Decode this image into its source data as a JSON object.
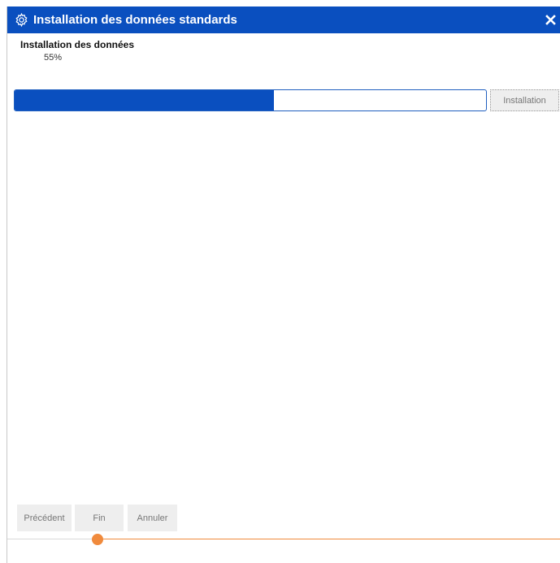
{
  "window": {
    "title": "Installation des données standards",
    "title_icon": "gear-icon",
    "close_icon": "close-icon",
    "accent_color": "#0a4fbf"
  },
  "progress": {
    "label": "Installation des données",
    "percent_text": "55%",
    "value": 0.55,
    "fill_color": "#0a4fbf"
  },
  "install_button": {
    "label": "Installation"
  },
  "footer": {
    "previous_label": "Précédent",
    "finish_label": "Fin",
    "cancel_label": "Annuler"
  },
  "slider": {
    "color": "#f08a3c",
    "value": 0.15
  }
}
